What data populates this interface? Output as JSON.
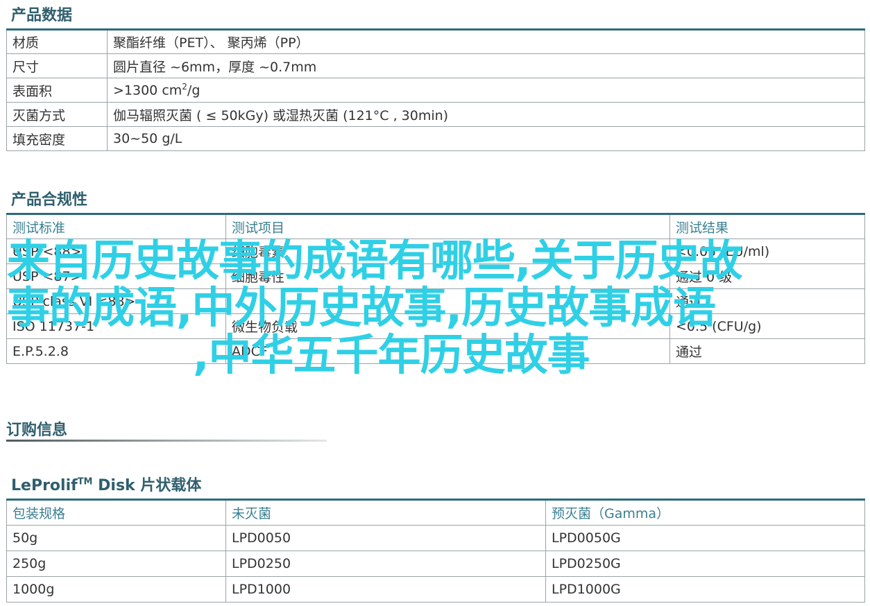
{
  "sections": {
    "product_data": {
      "title": "产品数据",
      "rows": [
        {
          "key": "材质",
          "value": "聚酯纤维（PET）、 聚丙烯（PP）"
        },
        {
          "key": "尺寸",
          "value": "圆片直径 ~6mm，厚度 ~0.7mm"
        },
        {
          "key": "表面积",
          "value_prefix": ">1300 cm",
          "value_sup": "2",
          "value_suffix": "/g"
        },
        {
          "key": "灭菌方式",
          "value": "伽马辐照灭菌 ( ≤ 50kGy) 或湿热灭菌 (121°C , 30min)"
        },
        {
          "key": "填充密度",
          "value": "30~50 g/L"
        }
      ]
    },
    "compliance": {
      "title": "产品合规性",
      "headers": [
        "测试标准",
        "测试项目",
        "测试结果"
      ],
      "rows": [
        [
          "USP <88>",
          "细胞毒素",
          "<0.05 (EU/ml)"
        ],
        [
          "USP <87>",
          "细胞毒性",
          "通过 0 级"
        ],
        [
          "USP class VI <88>",
          "",
          "通过"
        ],
        [
          "ISO 11737-1",
          "微生物负载",
          "<0.5 (CFU/g)"
        ],
        [
          "E.P.5.2.8",
          "ADCF",
          "通过"
        ]
      ]
    },
    "order": {
      "title": "订购信息",
      "product_name": "LeProlif",
      "product_tm": "TM",
      "product_suffix": " Disk 片状载体",
      "headers": [
        "包装规格",
        "未灭菌",
        "预灭菌（Gamma）"
      ],
      "rows": [
        [
          "50g",
          "LPD0050",
          "LPD0050G"
        ],
        [
          "250g",
          "LPD0250",
          "LPD0250G"
        ],
        [
          "1000g",
          "LPD1000",
          "LPD1000G"
        ]
      ]
    }
  },
  "watermark": {
    "line1": "来自历史故事的成语有哪些,关于历史故",
    "line2": "事的成语,中外历史故事,历史故事成语",
    "line3": ",中华五千年历史故事"
  }
}
